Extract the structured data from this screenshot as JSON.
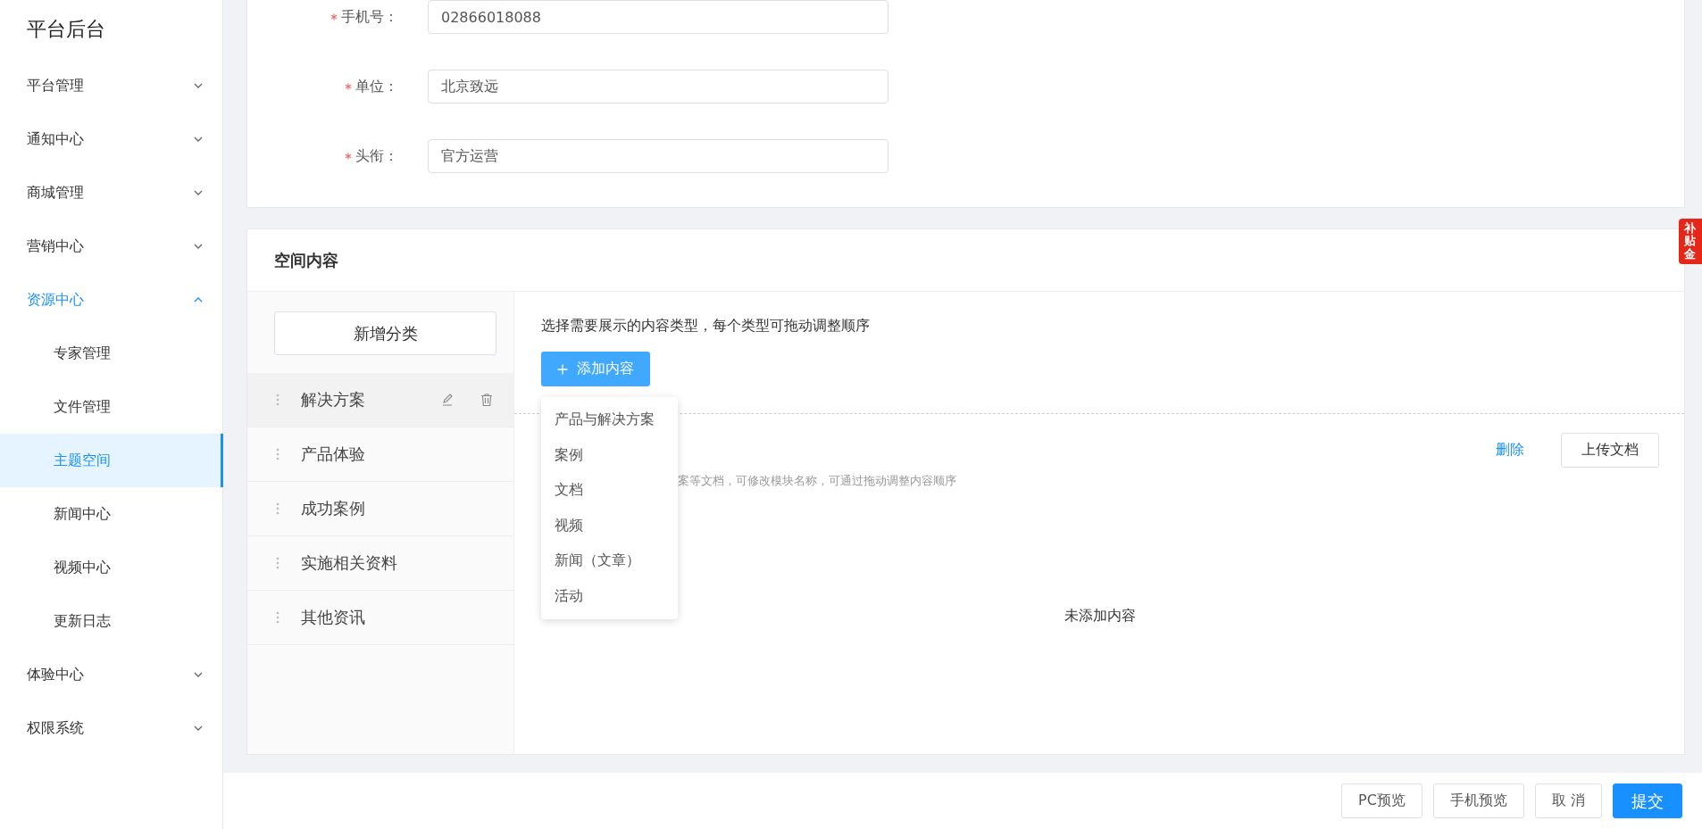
{
  "sidebar": {
    "title": "平台后台",
    "menu": [
      {
        "label": "平台管理",
        "expanded": false
      },
      {
        "label": "通知中心",
        "expanded": false
      },
      {
        "label": "商城管理",
        "expanded": false
      },
      {
        "label": "营销中心",
        "expanded": false
      },
      {
        "label": "资源中心",
        "expanded": true,
        "children": [
          {
            "label": "专家管理",
            "selected": false
          },
          {
            "label": "文件管理",
            "selected": false
          },
          {
            "label": "主题空间",
            "selected": true
          },
          {
            "label": "新闻中心",
            "selected": false
          },
          {
            "label": "视频中心",
            "selected": false
          },
          {
            "label": "更新日志",
            "selected": false
          }
        ]
      },
      {
        "label": "体验中心",
        "expanded": false
      },
      {
        "label": "权限系统",
        "expanded": false
      }
    ]
  },
  "form": {
    "fields": [
      {
        "label": "手机号：",
        "required": true,
        "value": "02866018088"
      },
      {
        "label": "单位：",
        "required": true,
        "value": "北京致远"
      },
      {
        "label": "头衔：",
        "required": true,
        "value": "官方运营"
      }
    ]
  },
  "space_content": {
    "title": "空间内容",
    "add_category_button": "新增分类",
    "categories": [
      {
        "label": "解决方案",
        "selected": true
      },
      {
        "label": "产品体验",
        "selected": false
      },
      {
        "label": "成功案例",
        "selected": false
      },
      {
        "label": "实施相关资料",
        "selected": false
      },
      {
        "label": "其他资讯",
        "selected": false
      }
    ],
    "instruction": "选择需要展示的内容类型，每个类型可拖动调整顺序",
    "add_content_button": "添加内容",
    "add_content_menu": [
      "产品与解决方案",
      "案例",
      "文档",
      "视频",
      "新闻（文章）",
      "活动"
    ],
    "module": {
      "hint": "案等文档，可修改模块名称，可通过拖动调整内容顺序",
      "delete_link": "删除",
      "upload_button": "上传文档",
      "empty_text": "未添加内容"
    }
  },
  "side_badge": "补贴金",
  "footer": {
    "buttons": [
      {
        "label": "PC预览",
        "kind": "default"
      },
      {
        "label": "手机预览",
        "kind": "default"
      },
      {
        "label": "取 消",
        "kind": "default"
      },
      {
        "label": "提交",
        "kind": "primary"
      }
    ]
  }
}
